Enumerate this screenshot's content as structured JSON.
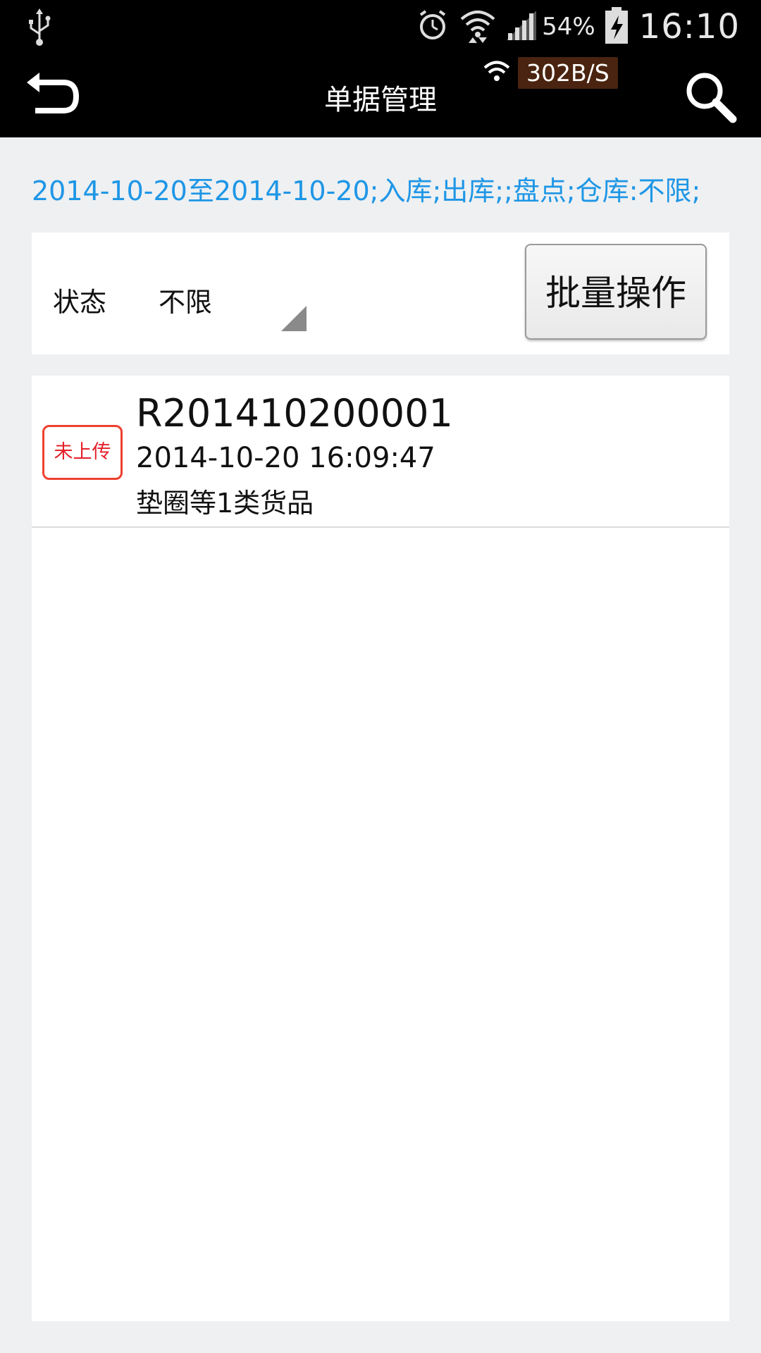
{
  "status_bar": {
    "battery_percent": "54%",
    "time": "16:10",
    "icons": [
      "usb-icon",
      "alarm-icon",
      "wifi-icon",
      "signal-icon",
      "battery-charging-icon"
    ]
  },
  "action_bar": {
    "title": "单据管理",
    "net_speed": "302B/S",
    "icons": [
      "back-icon",
      "wifi-icon",
      "search-icon"
    ]
  },
  "filter": {
    "summary": "2014-10-20至2014-10-20;入库;出库;;盘点;仓库:不限;",
    "status_label": "状态",
    "status_value": "不限",
    "batch_button_label": "批量操作"
  },
  "documents": [
    {
      "badge": "未上传",
      "number": "R201410200001",
      "datetime": "2014-10-20 16:09:47",
      "goods": "垫圈等1类货品"
    }
  ],
  "colors": {
    "accent_link": "#1e96e6",
    "badge_red": "#e4202a",
    "page_background": "#eef0f2",
    "bar_background": "#000000"
  }
}
